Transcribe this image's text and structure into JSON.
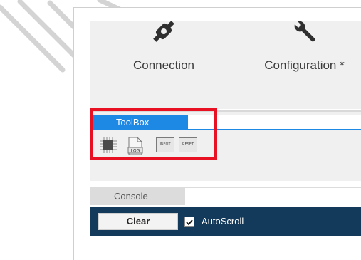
{
  "ribbon": {
    "items": [
      {
        "label": "Connection",
        "icon": "plug-icon"
      },
      {
        "label": "Configuration *",
        "icon": "wrench-icon"
      }
    ]
  },
  "toolbox": {
    "tab_label": "ToolBox",
    "buttons": [
      {
        "icon": "chip-icon"
      },
      {
        "icon": "log-file-icon",
        "text": "LOG"
      },
      {
        "icon": "infot-icon",
        "text": "INFOT"
      },
      {
        "icon": "reset-icon",
        "text": "RESET"
      }
    ]
  },
  "console": {
    "tab_label": "Console",
    "clear_label": "Clear",
    "autoscroll_label": "AutoScroll",
    "autoscroll_checked": true
  },
  "colors": {
    "accent": "#1e88e5",
    "highlight": "#e81123",
    "footer": "#133a5a"
  }
}
